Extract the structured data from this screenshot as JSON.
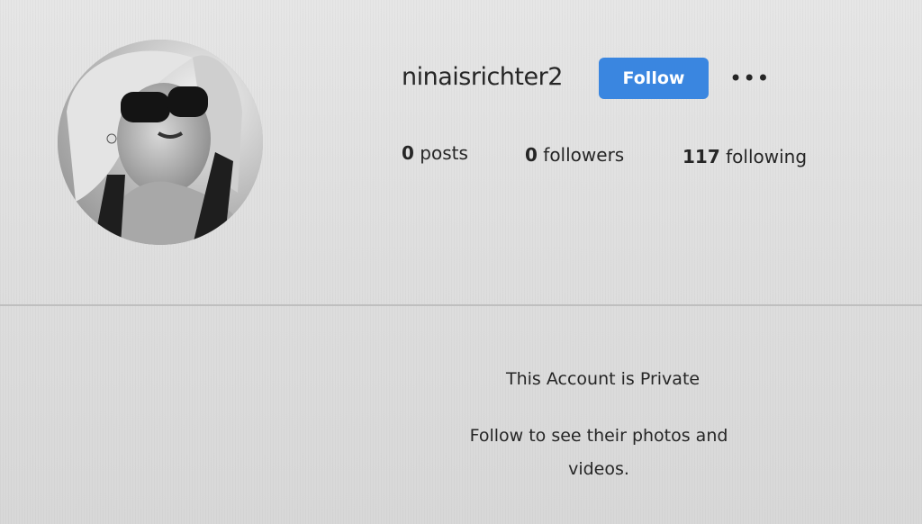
{
  "profile": {
    "username": "ninaisrichter2",
    "follow_label": "Follow",
    "more_label": "•••",
    "stats": {
      "posts_count": "0",
      "posts_label": "posts",
      "followers_count": "0",
      "followers_label": "followers",
      "following_count": "117",
      "following_label": "following"
    }
  },
  "private": {
    "title": "This Account is Private",
    "message": "Follow to see their photos and videos."
  },
  "colors": {
    "follow_button": "#3a86e0",
    "text": "#262626"
  }
}
